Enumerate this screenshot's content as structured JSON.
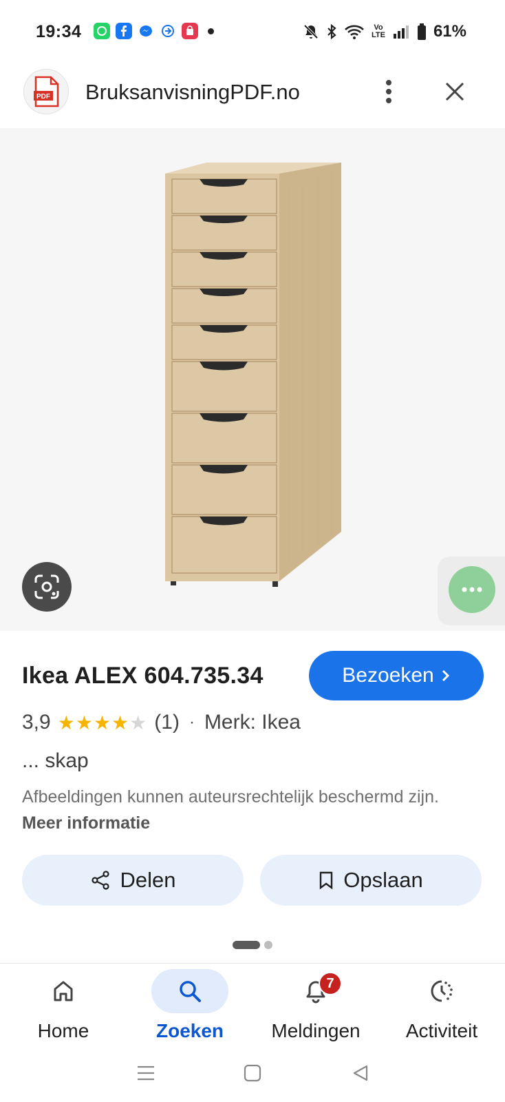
{
  "status_bar": {
    "time": "19:34",
    "battery": "61%",
    "volte_top": "Vo",
    "volte_bottom": "LTE"
  },
  "header": {
    "site_name": "BruksanvisningPDF.no",
    "logo_text": "PDF"
  },
  "product": {
    "title": "Ikea ALEX 604.735.34",
    "visit_label": "Bezoeken",
    "rating_value": "3,9",
    "rating_stars": 3.9,
    "rating_count": "(1)",
    "separator": "·",
    "brand": "Merk: Ikea",
    "category": "... skap",
    "copyright_text": "Afbeeldingen kunnen auteursrechtelijk beschermd zijn.",
    "more_info": "Meer informatie"
  },
  "actions": {
    "share_label": "Delen",
    "save_label": "Opslaan"
  },
  "bottom_nav": {
    "items": [
      {
        "label": "Home",
        "icon": "home-icon"
      },
      {
        "label": "Zoeken",
        "icon": "search-icon"
      },
      {
        "label": "Meldingen",
        "icon": "bell-icon",
        "badge": "7"
      },
      {
        "label": "Activiteit",
        "icon": "activity-icon"
      }
    ],
    "active_index": 1
  },
  "colors": {
    "accent": "#1a73e8",
    "active_nav": "#0b57d0",
    "star": "#f5b400",
    "badge": "#c5221f",
    "wood": "#d9c3a0"
  }
}
